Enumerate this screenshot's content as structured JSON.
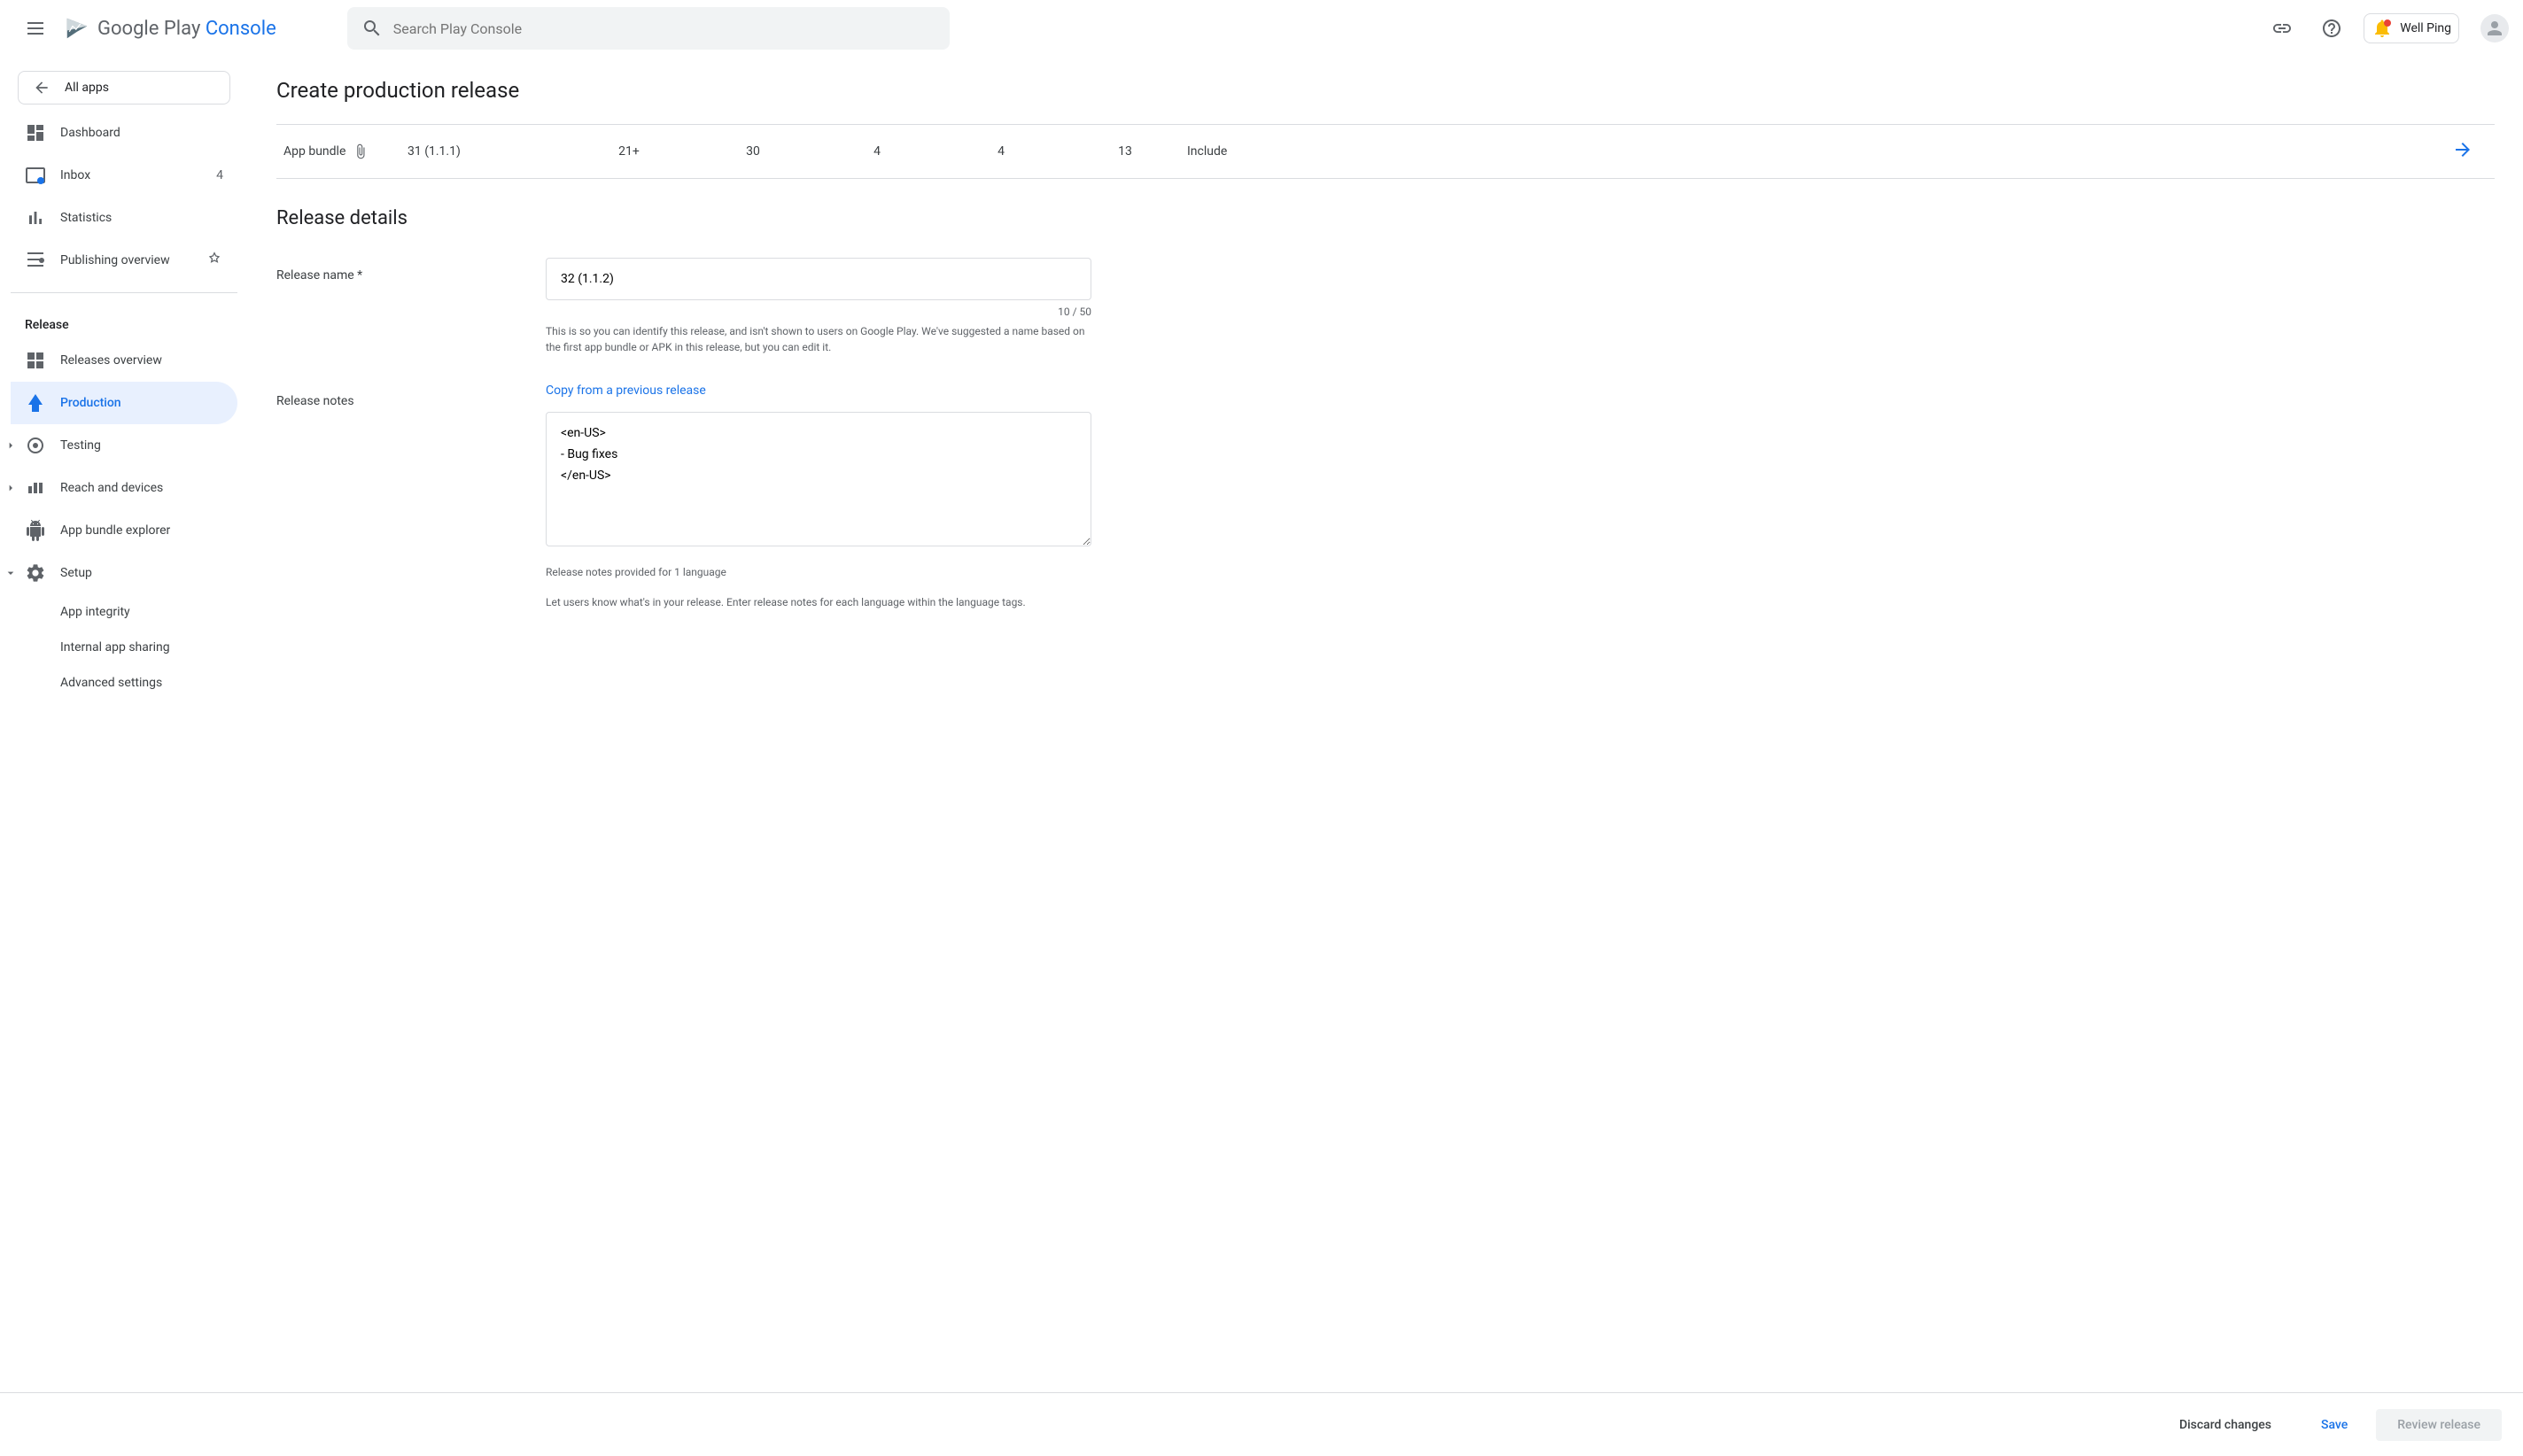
{
  "header": {
    "logo_text_a": "Google Play ",
    "logo_text_b": "Console",
    "search_placeholder": "Search Play Console",
    "user_name": "Well Ping"
  },
  "sidebar": {
    "all_apps": "All apps",
    "items": [
      {
        "label": "Dashboard"
      },
      {
        "label": "Inbox",
        "badge": "4"
      },
      {
        "label": "Statistics"
      },
      {
        "label": "Publishing overview"
      }
    ],
    "release_section": "Release",
    "release_items": [
      {
        "label": "Releases overview"
      },
      {
        "label": "Production"
      },
      {
        "label": "Testing"
      },
      {
        "label": "Reach and devices"
      },
      {
        "label": "App bundle explorer"
      },
      {
        "label": "Setup"
      }
    ],
    "setup_sub": [
      {
        "label": "App integrity"
      },
      {
        "label": "Internal app sharing"
      },
      {
        "label": "Advanced settings"
      }
    ]
  },
  "main": {
    "page_title": "Create production release",
    "table_row": {
      "type": "App bundle",
      "version": "31 (1.1.1)",
      "sdk": "21+",
      "target": "30",
      "col4a": "4",
      "col4b": "4",
      "col13": "13",
      "include": "Include"
    },
    "section_title": "Release details",
    "release_name_label": "Release name  *",
    "release_name_value": "32 (1.1.2)",
    "char_count": "10 / 50",
    "release_name_help": "This is so you can identify this release, and isn't shown to users on Google Play. We've suggested a name based on the first app bundle or APK in this release, but you can edit it.",
    "release_notes_label": "Release notes",
    "copy_link": "Copy from a previous release",
    "release_notes_value": "<en-US>\n- Bug fixes\n</en-US>",
    "notes_provided": "Release notes provided for 1 language",
    "notes_help": "Let users know what's in your release. Enter release notes for each language within the language tags."
  },
  "footer": {
    "discard": "Discard changes",
    "save": "Save",
    "review": "Review release"
  }
}
